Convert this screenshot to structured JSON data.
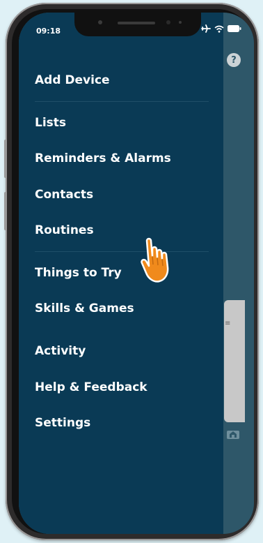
{
  "status_bar": {
    "time": "09:18"
  },
  "menu": {
    "items": [
      {
        "label": "Add Device"
      },
      {
        "label": "Lists"
      },
      {
        "label": "Reminders & Alarms"
      },
      {
        "label": "Contacts"
      },
      {
        "label": "Routines"
      },
      {
        "label": "Things to Try"
      },
      {
        "label": "Skills & Games"
      },
      {
        "label": "Activity"
      },
      {
        "label": "Help & Feedback"
      },
      {
        "label": "Settings"
      }
    ]
  },
  "icons": {
    "help": "question-icon",
    "home": "home-icon",
    "cursor": "hand-pointer-icon",
    "status": [
      "airplane-icon",
      "wifi-icon",
      "battery-icon"
    ]
  },
  "colors": {
    "drawer_bg": "#0a3a55",
    "app_bg": "#2e5769",
    "text": "#ffffff",
    "cursor_fill": "#f08a1c"
  }
}
